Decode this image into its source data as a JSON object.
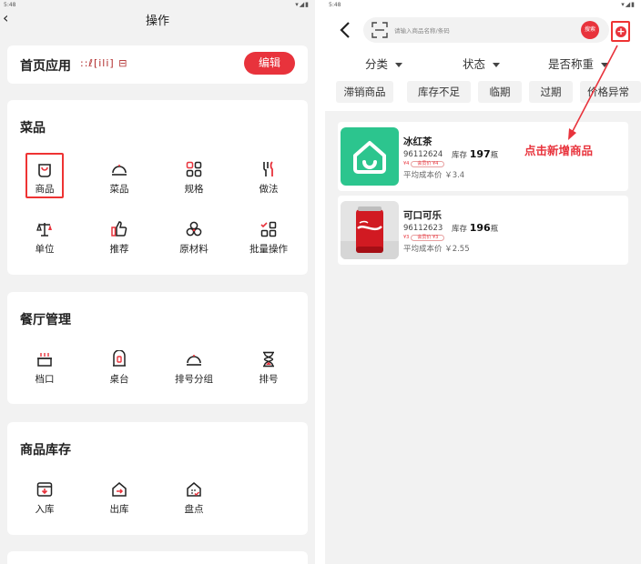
{
  "left": {
    "status_time": "5:48",
    "status_icons": "▾◢▮",
    "back_glyph": "‹",
    "title": "操作",
    "home_apps": {
      "label": "首页应用",
      "icons_text": "꞉꞉ℓ[ili] ⊟",
      "edit_label": "编辑"
    },
    "dishes": {
      "title": "菜品",
      "items": [
        {
          "label": "商品",
          "icon": "bag-icon"
        },
        {
          "label": "菜品",
          "icon": "cloche-icon"
        },
        {
          "label": "规格",
          "icon": "grid-icon"
        },
        {
          "label": "做法",
          "icon": "utensils-icon"
        },
        {
          "label": "单位",
          "icon": "scale-icon"
        },
        {
          "label": "推荐",
          "icon": "thumbs-up-icon"
        },
        {
          "label": "原材料",
          "icon": "ingredients-icon"
        },
        {
          "label": "批量操作",
          "icon": "batch-icon"
        }
      ]
    },
    "restaurant": {
      "title": "餐厅管理",
      "items": [
        {
          "label": "档口",
          "icon": "stall-icon"
        },
        {
          "label": "桌台",
          "icon": "table-icon"
        },
        {
          "label": "排号分组",
          "icon": "cloche-icon"
        },
        {
          "label": "排号",
          "icon": "hourglass-icon"
        }
      ]
    },
    "stock": {
      "title": "商品库存",
      "items": [
        {
          "label": "入库",
          "icon": "inbox-icon"
        },
        {
          "label": "出库",
          "icon": "outbox-icon"
        },
        {
          "label": "盘点",
          "icon": "inventory-icon"
        }
      ]
    }
  },
  "right": {
    "status_time": "5:48",
    "status_icons": "▾◢▮",
    "search": {
      "placeholder": "请输入商品名称/条码",
      "button": "搜索"
    },
    "add_glyph": "+",
    "filters": [
      {
        "label": "分类"
      },
      {
        "label": "状态"
      },
      {
        "label": "是否称重"
      }
    ],
    "tags": [
      "滞销商品",
      "库存不足",
      "临期",
      "过期",
      "价格异常"
    ],
    "products": [
      {
        "name": "冰红茶",
        "code": "96112624",
        "stock_label": "库存",
        "stock_value": "197",
        "stock_unit": "瓶",
        "badge_prefix": "¥4",
        "badge_text": "会员价 ¥4",
        "cost": "平均成本价 ￥3.4"
      },
      {
        "name": "可口可乐",
        "code": "96112623",
        "stock_label": "库存",
        "stock_value": "196",
        "stock_unit": "瓶",
        "badge_prefix": "¥3",
        "badge_text": "会员价 ¥3",
        "cost": "平均成本价 ￥2.55"
      }
    ],
    "annotation": "点击新增商品"
  },
  "colors": {
    "accent": "#e8333c",
    "page_bg": "#f2f2f2",
    "card_bg": "#ffffff",
    "tea_green": "#2cc58e"
  }
}
